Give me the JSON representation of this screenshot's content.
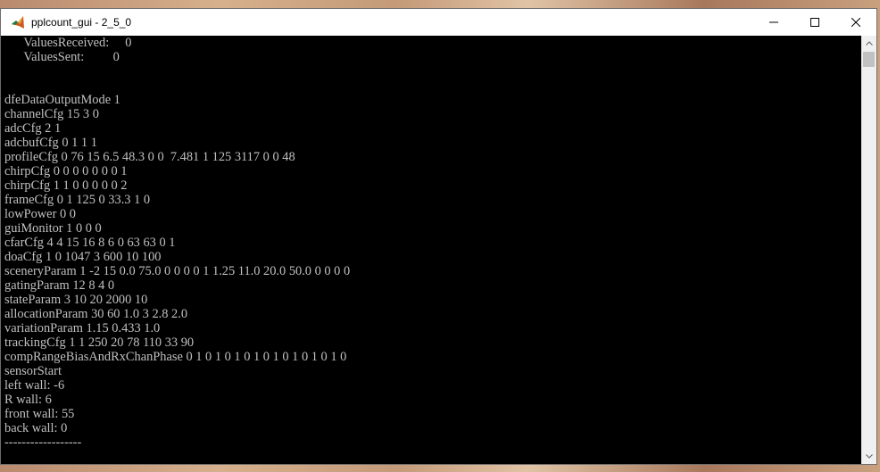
{
  "window": {
    "title": "pplcount_gui - 2_5_0"
  },
  "console": {
    "lines": [
      "      ValuesReceived:     0",
      "      ValuesSent:         0",
      "",
      "",
      "dfeDataOutputMode 1",
      "channelCfg 15 3 0",
      "adcCfg 2 1",
      "adcbufCfg 0 1 1 1",
      "profileCfg 0 76 15 6.5 48.3 0 0  7.481 1 125 3117 0 0 48",
      "chirpCfg 0 0 0 0 0 0 0 1",
      "chirpCfg 1 1 0 0 0 0 0 2",
      "frameCfg 0 1 125 0 33.3 1 0",
      "lowPower 0 0",
      "guiMonitor 1 0 0 0",
      "cfarCfg 4 4 15 16 8 6 0 63 63 0 1",
      "doaCfg 1 0 1047 3 600 10 100",
      "sceneryParam 1 -2 15 0.0 75.0 0 0 0 0 1 1.25 11.0 20.0 50.0 0 0 0 0",
      "gatingParam 12 8 4 0",
      "stateParam 3 10 20 2000 10",
      "allocationParam 30 60 1.0 3 2.8 2.0",
      "variationParam 1.15 0.433 1.0",
      "trackingCfg 1 1 250 20 78 110 33 90",
      "compRangeBiasAndRxChanPhase 0 1 0 1 0 1 0 1 0 1 0 1 0 1 0 1 0",
      "sensorStart",
      "left wall: -6",
      "R wall: 6",
      "front wall: 55",
      "back wall: 0",
      "------------------"
    ]
  },
  "icons": {
    "app": "matlab-icon",
    "minimize": "minimize-icon",
    "maximize": "maximize-icon",
    "close": "close-icon",
    "scroll_up": "chevron-up-icon",
    "scroll_down": "chevron-down-icon"
  },
  "colors": {
    "console_bg": "#000000",
    "console_text": "#c0c0c0",
    "titlebar_bg": "#ffffff",
    "scrollbar_bg": "#f0f0f0"
  }
}
